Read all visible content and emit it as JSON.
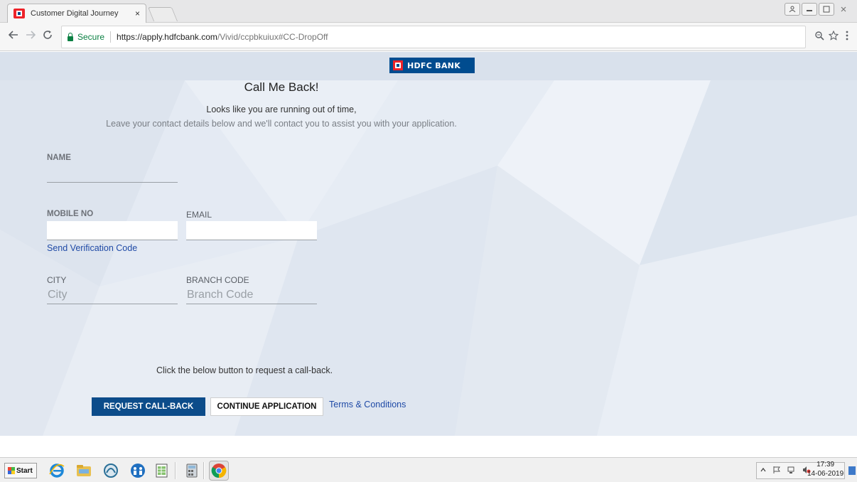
{
  "browser": {
    "tab_title": "Customer Digital Journey",
    "tab_close": "×",
    "url_secure_label": "Secure",
    "url_host": "https://apply.hdfcbank.com",
    "url_path": "/Vivid/ccpbkuiux#CC-DropOff",
    "icons": [
      "back-icon",
      "forward-icon",
      "reload-icon",
      "lock-icon",
      "zoom-icon",
      "star-icon",
      "menu-icon"
    ]
  },
  "page": {
    "logo_text": "HDFC BANK",
    "title": "Call Me Back!",
    "line1": "Looks like you are running out of time,",
    "line2": "Leave your contact details below and we'll contact you to assist you with your application.",
    "fields": {
      "name_label": "NAME",
      "mobile_label": "MOBILE NO",
      "email_label": "EMAIL",
      "send_code": "Send Verification Code",
      "city_label": "CITY",
      "city_placeholder": "City",
      "branch_label": "BRANCH CODE",
      "branch_placeholder": "Branch Code"
    },
    "hint": "Click the below button to request a call-back.",
    "request_button": "REQUEST CALL-BACK",
    "continue_button": "CONTINUE APPLICATION",
    "terms_link": "Terms & Conditions",
    "colors": {
      "brand_blue": "#004c8f",
      "brand_red": "#ed232a",
      "link": "#1f4aa6"
    }
  },
  "taskbar": {
    "start_label": "Start",
    "time": "17:39",
    "date": "14-06-2019"
  }
}
